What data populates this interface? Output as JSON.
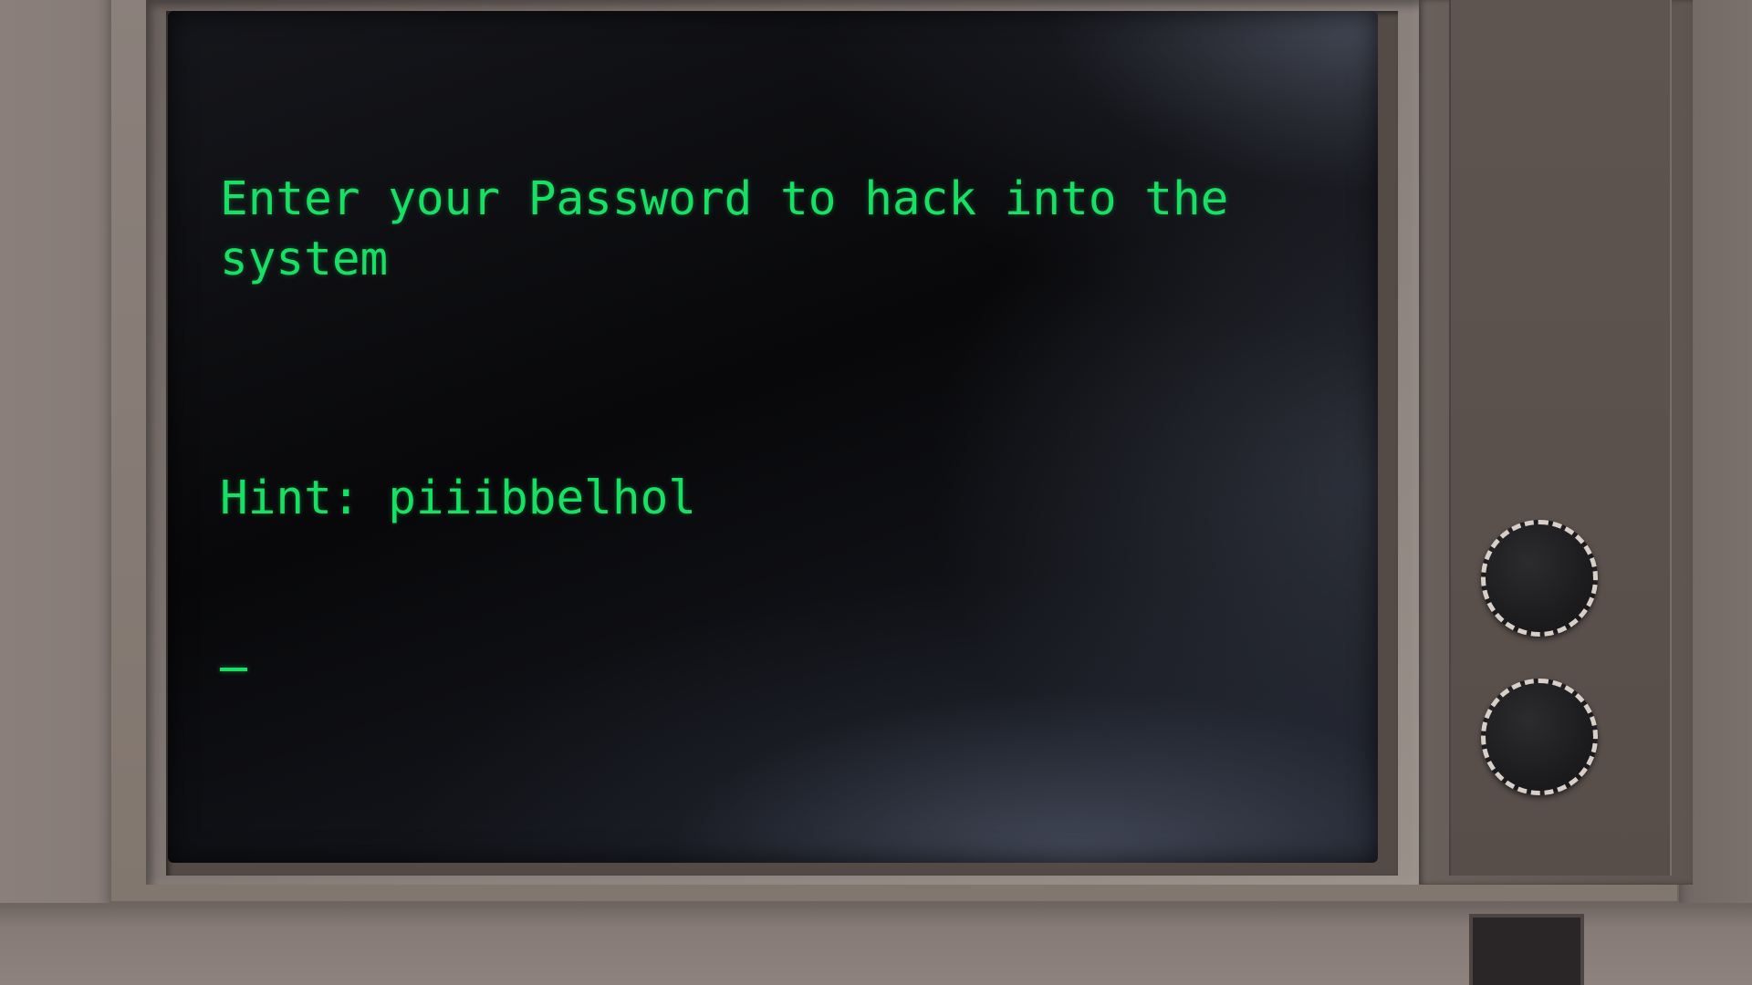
{
  "terminal": {
    "prompt": "Enter your Password to hack into the system",
    "hint": "Hint: piiibbelhol",
    "input_value": ""
  },
  "colors": {
    "terminal_text": "#18e065",
    "screen_bg": "#08080a",
    "bezel": "#82776f",
    "knob_ring": "#d8cfc9"
  },
  "controls": {
    "knobs": [
      "knob-1",
      "knob-2"
    ]
  }
}
